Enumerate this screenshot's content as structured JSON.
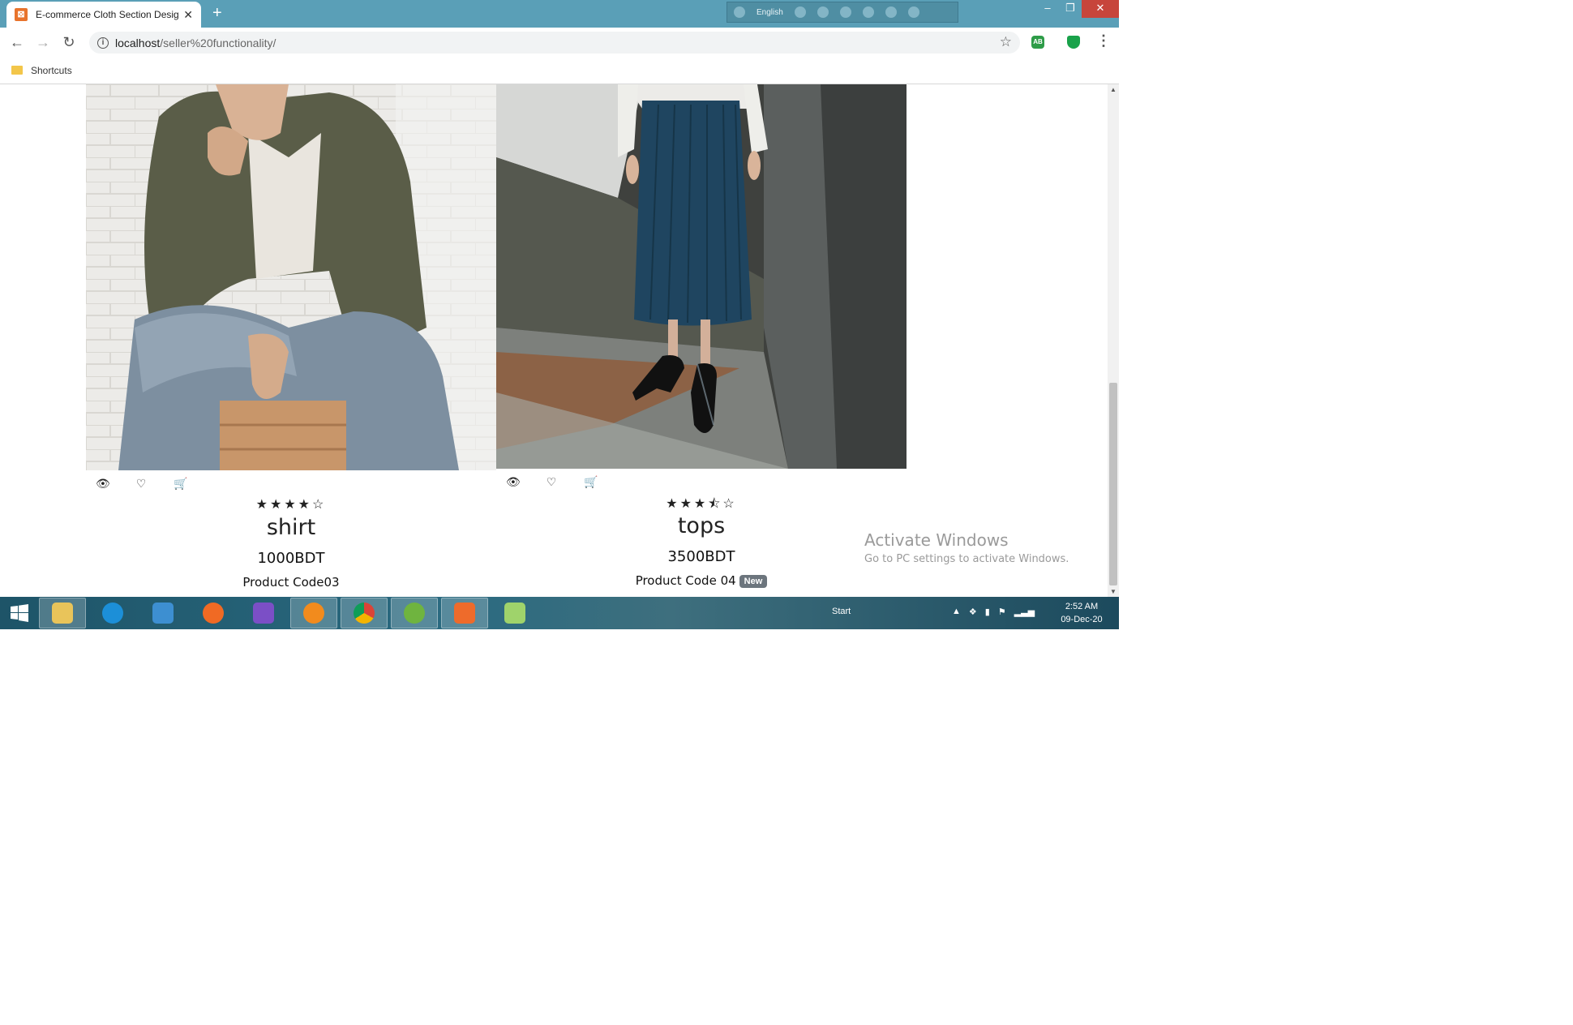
{
  "browser": {
    "tab_title": "E-commerce Cloth Section Desig",
    "favicon": "xampp-icon",
    "url_host": "localhost",
    "url_path": "/seller%20functionality/",
    "bookmark": "Shortcuts",
    "language": "English"
  },
  "products": [
    {
      "name": "shirt",
      "price": "1000BDT",
      "code": "Product Code03",
      "rating": 4,
      "rating_stars": "★★★★☆",
      "badge": ""
    },
    {
      "name": "tops",
      "price": "3500BDT",
      "code": "Product Code 04",
      "rating": 3.5,
      "rating_stars": "★★★⯪☆",
      "badge": "New"
    }
  ],
  "watermark": {
    "title": "Activate Windows",
    "subtitle": "Go to PC settings to activate Windows."
  },
  "taskbar": {
    "start_label": "Start",
    "time": "2:52 AM",
    "date": "09-Dec-20",
    "apps": [
      "file-explorer-icon",
      "internet-explorer-icon",
      "remote-desktop-icon",
      "firefox-icon",
      "visual-studio-icon",
      "settings-app-icon",
      "chrome-icon",
      "utorrent-icon",
      "xampp-icon",
      "notepad-icon"
    ]
  },
  "colors": {
    "titlebar": "#5a9fb7",
    "close_button": "#c7453b",
    "badge": "#6c757d",
    "taskbar": "#1e5468"
  }
}
